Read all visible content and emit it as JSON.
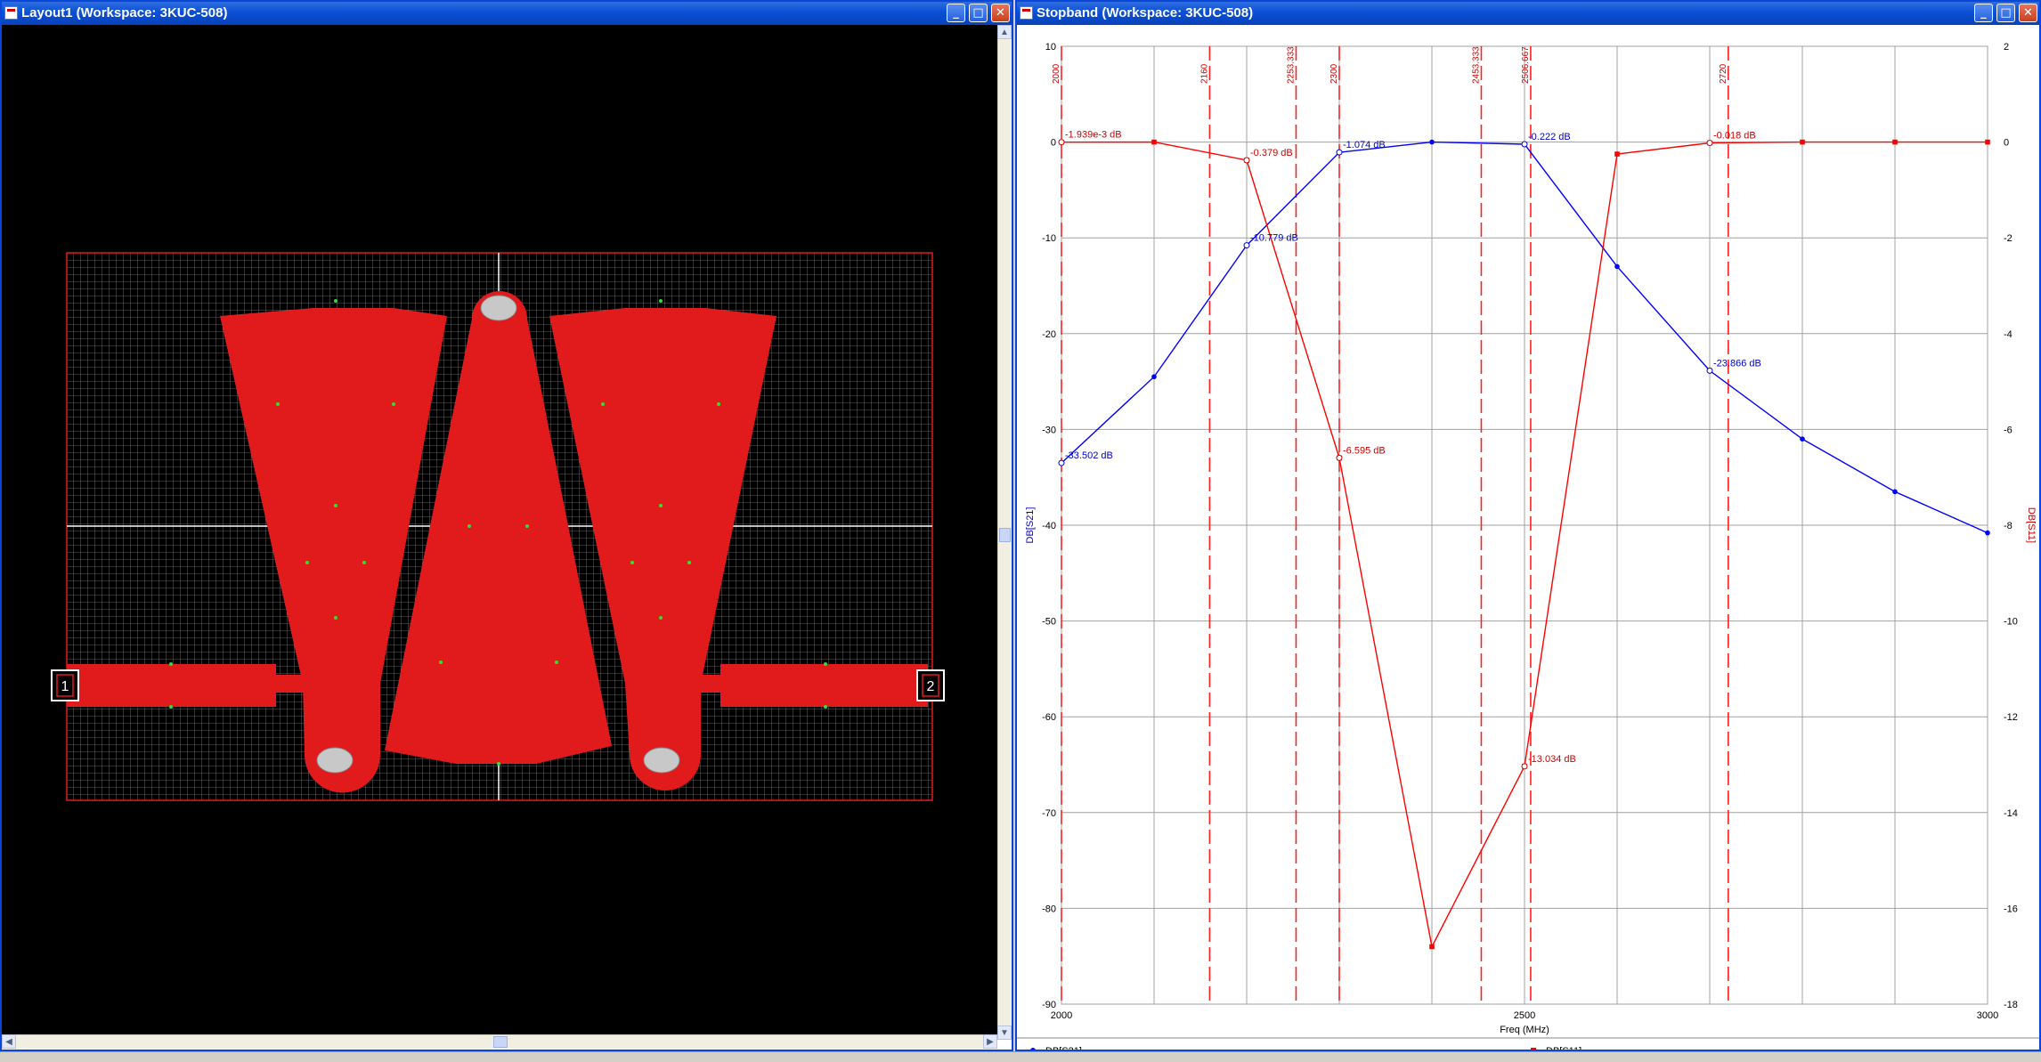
{
  "layout_window": {
    "title": "Layout1  (Workspace: 3KUC-508)",
    "port1_label": "1",
    "port2_label": "2"
  },
  "chart_window": {
    "title": "Stopband  (Workspace: 3KUC-508)"
  },
  "window_buttons": {
    "minimize": "_",
    "maximize": "□",
    "close": "✕"
  },
  "colors": {
    "s21": "#0000ff",
    "s11": "#ff0000",
    "metal": "#e11b1b",
    "grid": "#6a6a6a",
    "title_blue": "#0a50d6"
  },
  "chart_data": {
    "type": "line",
    "xlabel": "Freq (MHz)",
    "ylabel_left": "DB[S21]",
    "ylabel_right": "DB[S11]",
    "xlim": [
      2000,
      3000
    ],
    "ylim_left": [
      -90,
      10
    ],
    "ylim_right": [
      -18,
      2
    ],
    "x_ticks": [
      "2000",
      "2500",
      "3000"
    ],
    "y_ticks_left": [
      "10",
      "0",
      "-10",
      "-20",
      "-30",
      "-40",
      "-50",
      "-60",
      "-70",
      "-80",
      "-90"
    ],
    "y_ticks_right": [
      "2",
      "0",
      "-2",
      "-4",
      "-6",
      "-8",
      "-10",
      "-12",
      "-14",
      "-16",
      "-18"
    ],
    "grid": true,
    "legend_position": "bottom",
    "series": [
      {
        "name": "DB[S21]",
        "axis": "left",
        "x": [
          2000,
          2100,
          2200,
          2300,
          2400,
          2500,
          2600,
          2700,
          2800,
          2900,
          3000
        ],
        "y": [
          -33.502,
          -24.5,
          -10.779,
          -1.074,
          0,
          -0.222,
          -13,
          -23.866,
          -31,
          -36.5,
          -40.8
        ]
      },
      {
        "name": "DB[S11]",
        "axis": "right",
        "x": [
          2000,
          2100,
          2200,
          2300,
          2400,
          2500,
          2600,
          2700,
          2800,
          2900,
          3000
        ],
        "y": [
          -0.001939,
          0,
          -0.379,
          -6.595,
          -16.8,
          -13.034,
          -0.25,
          -0.018,
          0,
          0,
          0
        ]
      }
    ],
    "vertical_markers": [
      "2000",
      "2160",
      "2253.333",
      "2300",
      "2453.333",
      "2506.667",
      "2720"
    ],
    "marker_values": [
      2000,
      2160,
      2253.333,
      2300,
      2453.333,
      2506.667,
      2720
    ],
    "annotations": [
      {
        "series": "DB[S21]",
        "x": 2000,
        "y": -33.502,
        "text": "-33.502 dB"
      },
      {
        "series": "DB[S21]",
        "x": 2200,
        "y": -10.779,
        "text": "-10.779 dB"
      },
      {
        "series": "DB[S21]",
        "x": 2300,
        "y": -1.074,
        "text": "-1.074 dB"
      },
      {
        "series": "DB[S21]",
        "x": 2700,
        "y": -23.866,
        "text": "-23.866 dB"
      },
      {
        "series": "DB[S11]",
        "x": 2000,
        "y": -0.001939,
        "text": "-1.939e-3 dB"
      },
      {
        "series": "DB[S11]",
        "x": 2200,
        "y": -0.379,
        "text": "-0.379 dB"
      },
      {
        "series": "DB[S11]",
        "x": 2300,
        "y": -6.595,
        "text": "-6.595 dB"
      },
      {
        "series": "DB[S11]",
        "x": 2500,
        "y": -13.034,
        "text": "-13.034 dB"
      },
      {
        "series": "DB[S21]",
        "x": 2500,
        "y": -0.222,
        "text": "-0.222 dB"
      },
      {
        "series": "DB[S11]",
        "x": 2700,
        "y": -0.018,
        "text": "-0.018 dB"
      }
    ]
  }
}
